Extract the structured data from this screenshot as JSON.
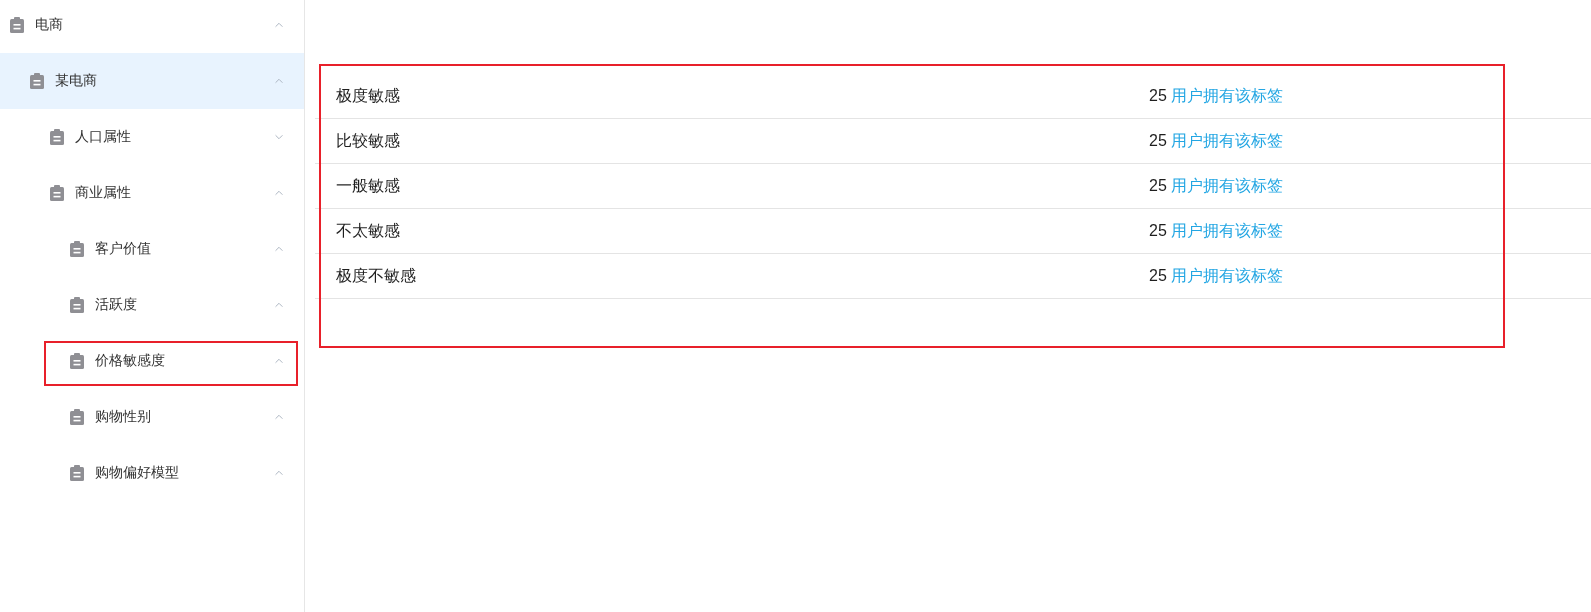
{
  "sidebar": {
    "items": [
      {
        "label": "电商",
        "expanded": true,
        "selected": false,
        "children": [
          {
            "label": "某电商",
            "expanded": true,
            "selected": true,
            "children": [
              {
                "label": "人口属性",
                "expanded": false,
                "selected": false
              },
              {
                "label": "商业属性",
                "expanded": true,
                "selected": false,
                "children": [
                  {
                    "label": "客户价值",
                    "expanded": true,
                    "selected": false,
                    "highlighted": false
                  },
                  {
                    "label": "活跃度",
                    "expanded": true,
                    "selected": false,
                    "highlighted": false
                  },
                  {
                    "label": "价格敏感度",
                    "expanded": true,
                    "selected": false,
                    "highlighted": true
                  },
                  {
                    "label": "购物性别",
                    "expanded": true,
                    "selected": false,
                    "highlighted": false
                  },
                  {
                    "label": "购物偏好模型",
                    "expanded": true,
                    "selected": false,
                    "highlighted": false
                  }
                ]
              }
            ]
          }
        ]
      }
    ]
  },
  "table": {
    "highlighted": true,
    "rows": [
      {
        "name": "极度敏感",
        "count": "25",
        "link": "用户拥有该标签"
      },
      {
        "name": "比较敏感",
        "count": "25",
        "link": "用户拥有该标签"
      },
      {
        "name": "一般敏感",
        "count": "25",
        "link": "用户拥有该标签"
      },
      {
        "name": "不太敏感",
        "count": "25",
        "link": "用户拥有该标签"
      },
      {
        "name": "极度不敏感",
        "count": "25",
        "link": "用户拥有该标签"
      }
    ]
  }
}
